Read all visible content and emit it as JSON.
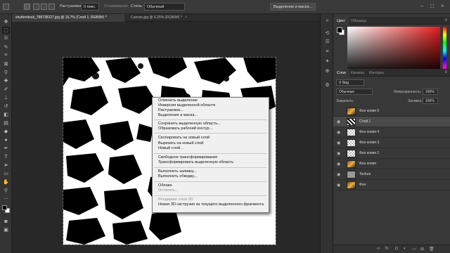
{
  "options_bar": {
    "feather_label": "Растушевка:",
    "feather_value": "0 пикс.",
    "smooth_label": "Сглаживание",
    "style_label": "Стиль:",
    "style_value": "Обычный",
    "select_mask_button": "Выделение и маска..."
  },
  "tabs": [
    {
      "label": "shutterstock_788738227.jpg @ 16,7% (Слой 1, RGB/8#) *",
      "active": true
    },
    {
      "label": "Canvas.jpg @ 6,25% (RGB/8#) *",
      "active": false
    }
  ],
  "context_menu": {
    "items": [
      {
        "label": "Отменить выделение",
        "disabled": false
      },
      {
        "label": "Инверсия выделенной области",
        "disabled": false
      },
      {
        "label": "Растушевка...",
        "disabled": false
      },
      {
        "label": "Выделение и маска...",
        "disabled": false
      },
      {
        "label": "Сохранить выделенную область...",
        "disabled": false
      },
      {
        "label": "Образовать рабочий контур...",
        "disabled": false
      },
      {
        "label": "Скопировать на новый слой",
        "disabled": false
      },
      {
        "label": "Вырезать на новый слой",
        "disabled": false
      },
      {
        "label": "Новый слой...",
        "disabled": false
      },
      {
        "label": "Свободное трансформирование",
        "disabled": false
      },
      {
        "label": "Трансформировать выделенную область",
        "disabled": false
      },
      {
        "label": "Выполнить заливку...",
        "disabled": false
      },
      {
        "label": "Выполнить обводку...",
        "disabled": false
      },
      {
        "label": "Облака",
        "disabled": false
      },
      {
        "label": "Остатить...",
        "disabled": true
      },
      {
        "label": "Рендеринг слоя 3D",
        "disabled": true
      },
      {
        "label": "Новая 3D-экструзия из текущего выделенного фрагмента",
        "disabled": false
      }
    ]
  },
  "color_panel": {
    "tabs": [
      "Цвет",
      "Образцы"
    ],
    "accent": "#e31b1b"
  },
  "layers_panel": {
    "tabs": [
      "Слои",
      "Каналы",
      "Контуры"
    ],
    "filter_label": "Вид",
    "blend_mode": "Обычные",
    "opacity_label": "Непрозрачность:",
    "opacity_value": "100%",
    "lock_label": "Закрепить:",
    "fill_label": "Заливка:",
    "fill_value": "100%",
    "layers": [
      {
        "name": "Фон копия 5",
        "visible": false,
        "selected": false,
        "thumb": "photo"
      },
      {
        "name": "Слой 1",
        "visible": true,
        "selected": true,
        "thumb": "pattern"
      },
      {
        "name": "Фон копия 4",
        "visible": true,
        "selected": false,
        "thumb": "checker"
      },
      {
        "name": "Фон копия 3",
        "visible": true,
        "selected": false,
        "thumb": "checker"
      },
      {
        "name": "Фон копия 2",
        "visible": true,
        "selected": false,
        "thumb": "checker"
      },
      {
        "name": "Фон копия",
        "visible": true,
        "selected": false,
        "thumb": "photo"
      },
      {
        "name": "Texture",
        "visible": true,
        "selected": false,
        "thumb": "gray"
      },
      {
        "name": "Фон",
        "visible": true,
        "selected": false,
        "thumb": "photo"
      }
    ]
  }
}
